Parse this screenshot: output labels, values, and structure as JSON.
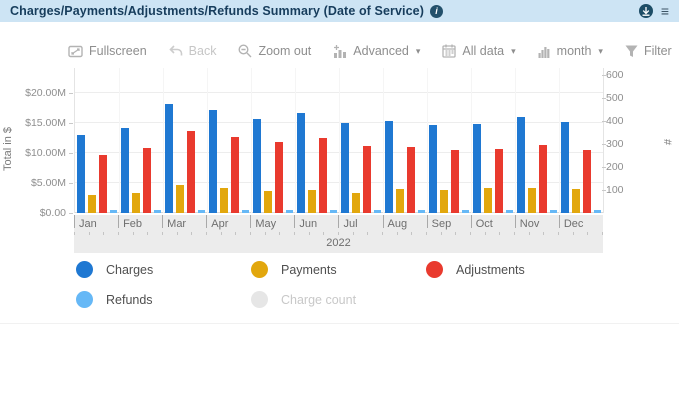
{
  "header": {
    "title": "Charges/Payments/Adjustments/Refunds Summary (Date of Service)",
    "info_icon": "i"
  },
  "toolbar": {
    "fullscreen_label": "Fullscreen",
    "back_label": "Back",
    "zoom_out_label": "Zoom out",
    "advanced_label": "Advanced",
    "all_data_label": "All data",
    "interval_label": "month",
    "filter_label": "Filter",
    "caret": "▾"
  },
  "chart_data": {
    "type": "bar",
    "title": "Charges/Payments/Adjustments/Refunds Summary (Date of Service)",
    "categories": [
      "Jan",
      "Feb",
      "Mar",
      "Apr",
      "May",
      "Jun",
      "Jul",
      "Aug",
      "Sep",
      "Oct",
      "Nov",
      "Dec"
    ],
    "x_year_label": "2022",
    "ylabel_left": "Total in $",
    "ylabel_right": "#",
    "y_left_ticks": [
      {
        "label": "$20.00M",
        "value": 20
      },
      {
        "label": "$15.00M",
        "value": 15
      },
      {
        "label": "$10.00M",
        "value": 10
      },
      {
        "label": "$5.00M",
        "value": 5
      },
      {
        "label": "$0.00",
        "value": 0
      }
    ],
    "y_left_lim_millions": [
      0,
      24.2
    ],
    "y_right_ticks": [
      600,
      500,
      400,
      300,
      200,
      100
    ],
    "y_right_lim": [
      0,
      630
    ],
    "grid": true,
    "legend_position": "bottom",
    "series": [
      {
        "name": "Charges",
        "color": "#1f78d2",
        "unit": "$M",
        "plotted": true,
        "values": [
          13.0,
          14.2,
          18.2,
          17.1,
          15.7,
          16.6,
          15.0,
          15.4,
          14.7,
          14.9,
          16.0,
          15.1
        ]
      },
      {
        "name": "Payments",
        "color": "#e2a70d",
        "unit": "$M",
        "plotted": true,
        "values": [
          3.0,
          3.4,
          4.6,
          4.2,
          3.6,
          3.9,
          3.4,
          4.0,
          3.8,
          4.1,
          4.2,
          4.0
        ]
      },
      {
        "name": "Adjustments",
        "color": "#e93a2e",
        "unit": "$M",
        "plotted": true,
        "values": [
          9.7,
          10.8,
          13.6,
          12.7,
          11.8,
          12.5,
          11.2,
          11.0,
          10.5,
          10.6,
          11.4,
          10.5
        ]
      },
      {
        "name": "Refunds",
        "color": "#66b8f6",
        "unit": "$M",
        "plotted": true,
        "values": [
          0.4,
          0.4,
          0.5,
          0.4,
          0.4,
          0.5,
          0.4,
          0.4,
          0.4,
          0.4,
          0.5,
          0.4
        ]
      },
      {
        "name": "Charge count",
        "color": "#e6e6e6",
        "unit": "count",
        "plotted": false,
        "disabled": true,
        "values": []
      }
    ]
  }
}
